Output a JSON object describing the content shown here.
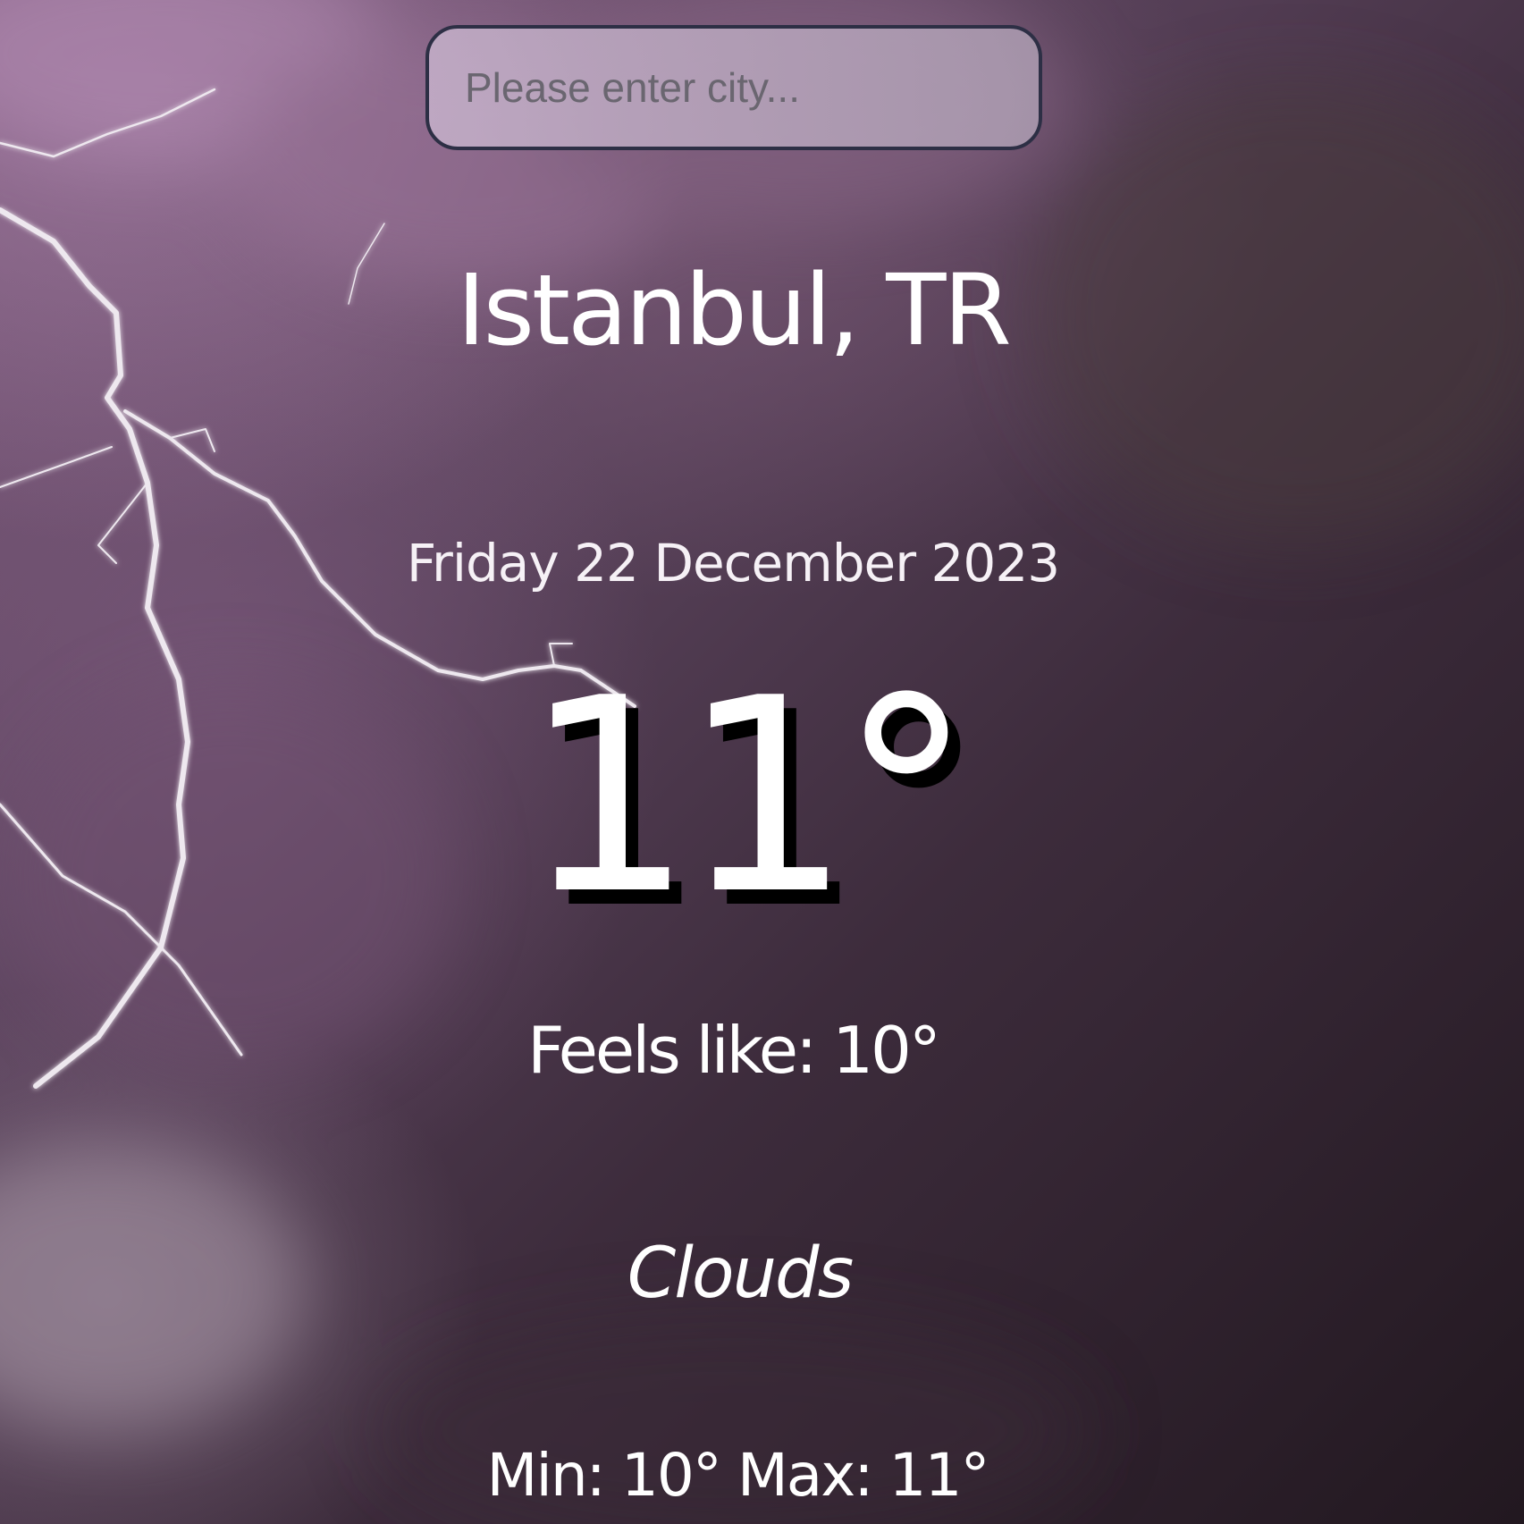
{
  "search": {
    "value": "",
    "placeholder": "Please enter city..."
  },
  "weather": {
    "location": "Istanbul, TR",
    "date": "Friday 22 December 2023",
    "temperature": "11°",
    "feels_like": "Feels like: 10°",
    "condition": "Clouds",
    "min_max": "Min: 10° Max: 11°"
  },
  "background": {
    "scene": "storm-clouds-lightning",
    "colors": {
      "light_purple": "#7d5a7c",
      "mid_purple": "#5e4660",
      "dark_plum": "#221820",
      "input_border": "#2d2f45"
    }
  }
}
